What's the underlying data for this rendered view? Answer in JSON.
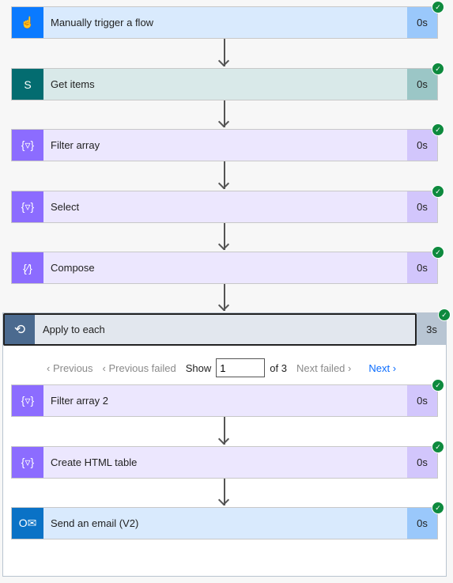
{
  "steps": [
    {
      "title": "Manually trigger a flow",
      "duration": "0s",
      "icon": "touch-icon",
      "theme": "blue"
    },
    {
      "title": "Get items",
      "duration": "0s",
      "icon": "sharepoint-icon",
      "theme": "sp"
    },
    {
      "title": "Filter array",
      "duration": "0s",
      "icon": "data-operation-icon",
      "theme": "purple"
    },
    {
      "title": "Select",
      "duration": "0s",
      "icon": "data-operation-icon",
      "theme": "purple"
    },
    {
      "title": "Compose",
      "duration": "0s",
      "icon": "compose-icon",
      "theme": "purple"
    }
  ],
  "loop": {
    "title": "Apply to each",
    "duration": "3s",
    "icon": "loop-icon",
    "pager": {
      "previous": "Previous",
      "previous_failed": "Previous failed",
      "show": "Show",
      "current": "1",
      "of": "of 3",
      "next_failed": "Next failed",
      "next": "Next"
    },
    "steps": [
      {
        "title": "Filter array 2",
        "duration": "0s",
        "icon": "data-operation-icon",
        "theme": "purple"
      },
      {
        "title": "Create HTML table",
        "duration": "0s",
        "icon": "data-operation-icon",
        "theme": "purple"
      },
      {
        "title": "Send an email (V2)",
        "duration": "0s",
        "icon": "outlook-icon",
        "theme": "ol"
      }
    ]
  },
  "colors": {
    "success": "#0e8a3e",
    "link": "#0a6cff",
    "trigger": "#0a7aff",
    "sharepoint": "#036c70",
    "data_operation": "#8c6cff",
    "loop": "#4b6a8f"
  }
}
